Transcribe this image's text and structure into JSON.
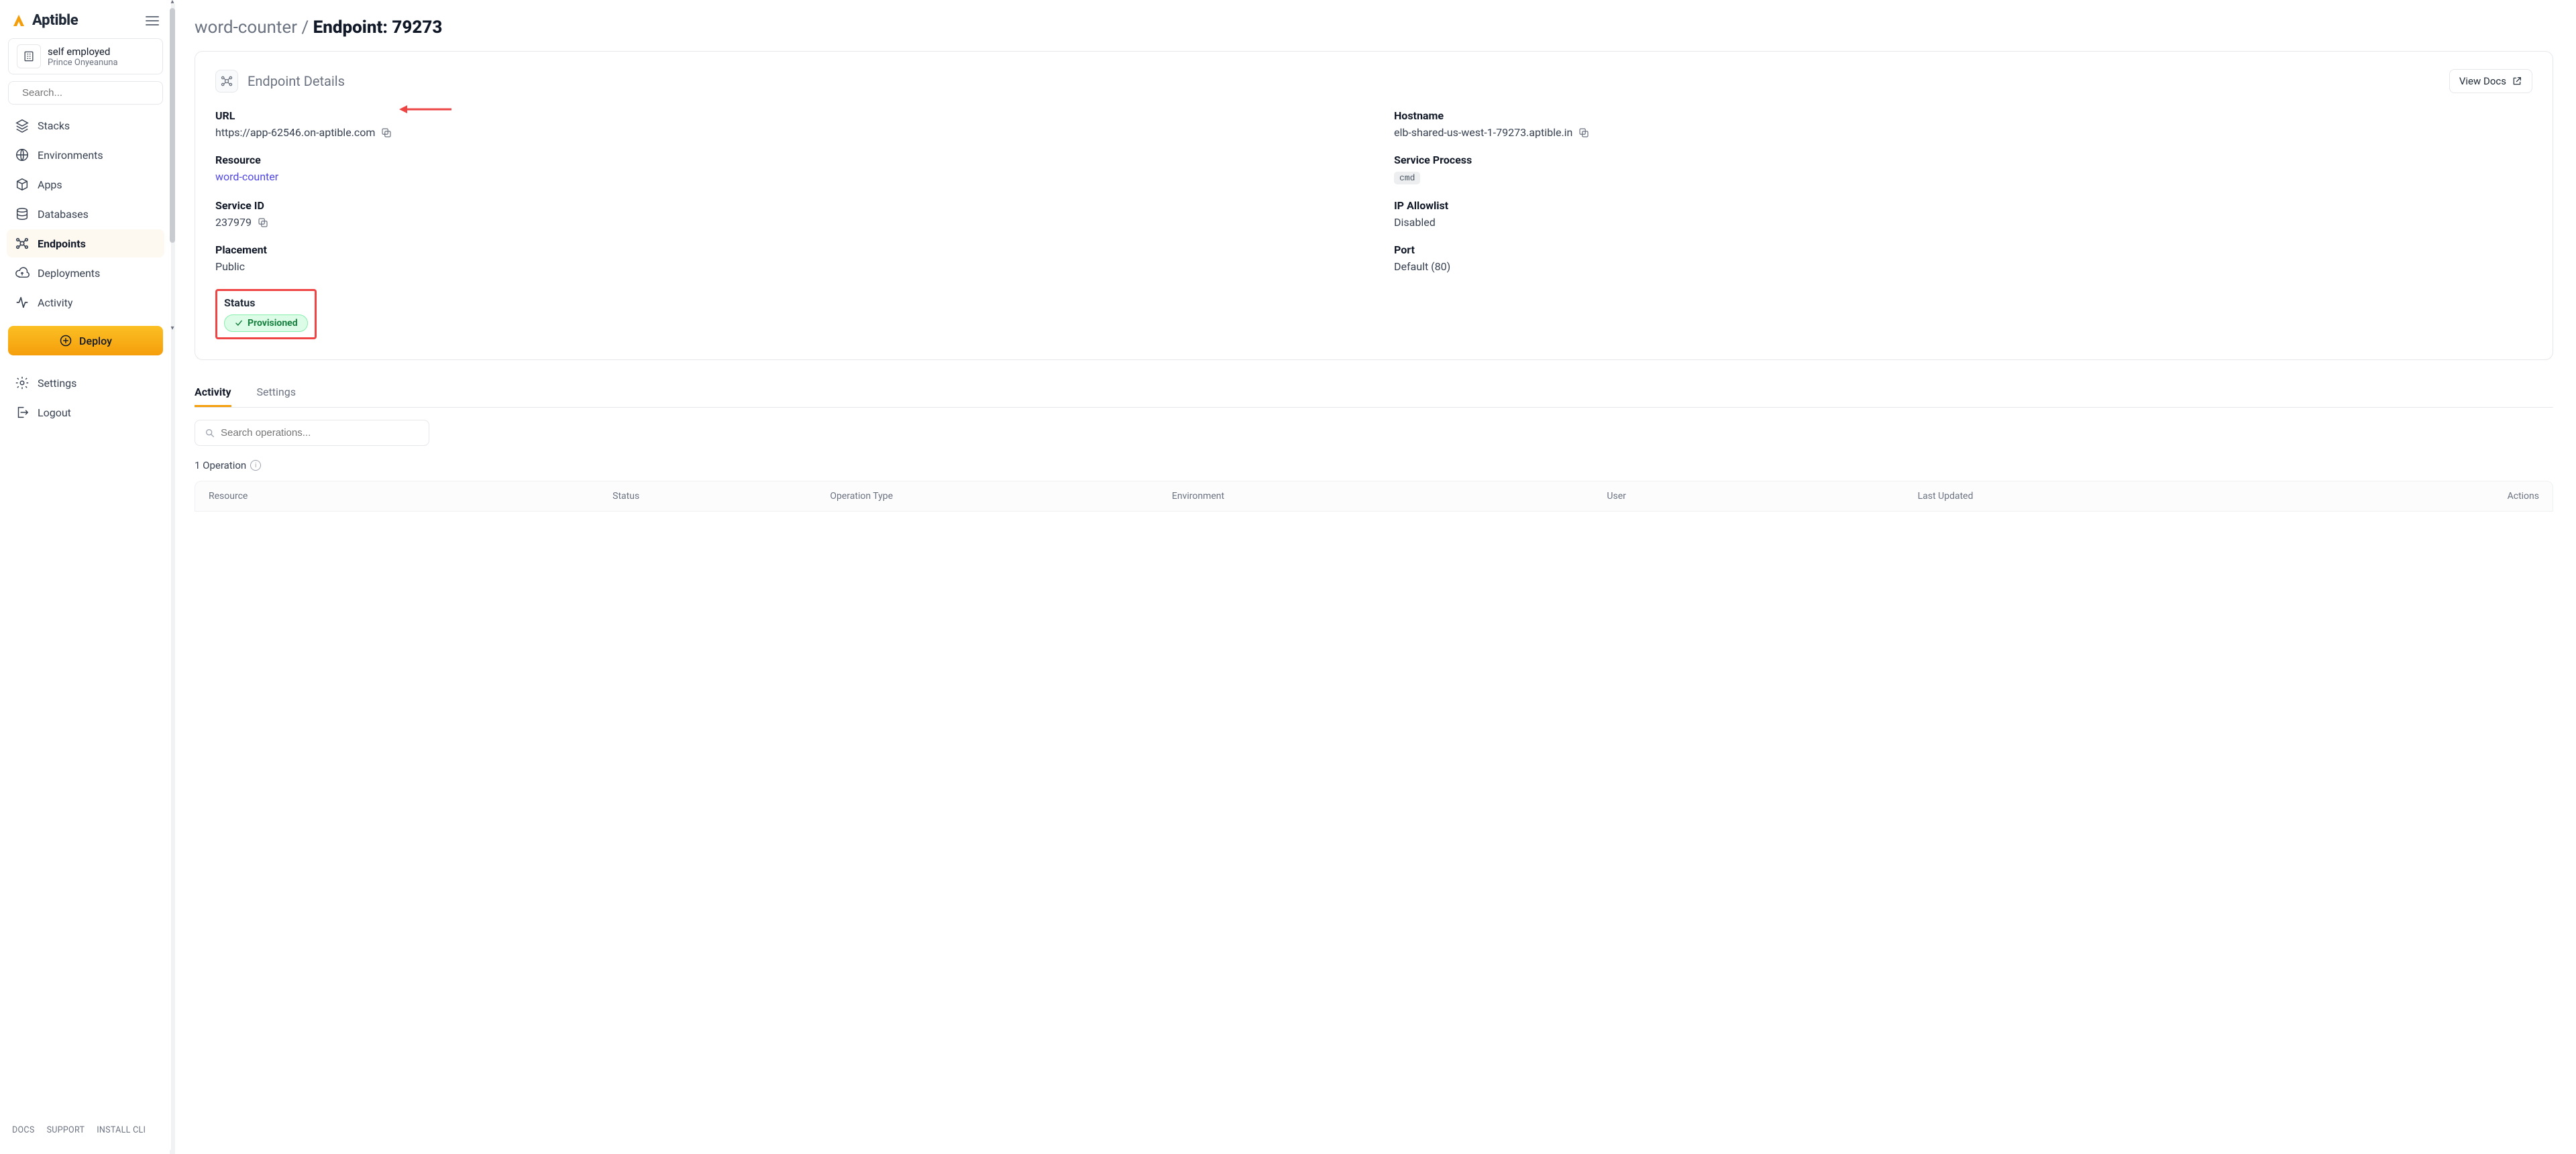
{
  "brand": "Aptible",
  "org": {
    "name": "self employed",
    "sub": "Prince Onyeanuna"
  },
  "search": {
    "placeholder": "Search..."
  },
  "nav": {
    "items": [
      {
        "label": "Stacks"
      },
      {
        "label": "Environments"
      },
      {
        "label": "Apps"
      },
      {
        "label": "Databases"
      },
      {
        "label": "Endpoints"
      },
      {
        "label": "Deployments"
      },
      {
        "label": "Activity"
      }
    ],
    "deploy": "Deploy",
    "settings": "Settings",
    "logout": "Logout"
  },
  "footerLinks": [
    "DOCS",
    "SUPPORT",
    "INSTALL CLI"
  ],
  "breadcrumb": {
    "app": "word-counter",
    "sep": "/",
    "pageLabel": "Endpoint:",
    "id": "79273"
  },
  "panel": {
    "title": "Endpoint Details",
    "viewDocs": "View Docs"
  },
  "details": {
    "url": {
      "label": "URL",
      "value": "https://app-62546.on-aptible.com"
    },
    "hostname": {
      "label": "Hostname",
      "value": "elb-shared-us-west-1-79273.aptible.in"
    },
    "resource": {
      "label": "Resource",
      "value": "word-counter"
    },
    "serviceProcess": {
      "label": "Service Process",
      "value": "cmd"
    },
    "serviceId": {
      "label": "Service ID",
      "value": "237979"
    },
    "ipAllowlist": {
      "label": "IP Allowlist",
      "value": "Disabled"
    },
    "placement": {
      "label": "Placement",
      "value": "Public"
    },
    "port": {
      "label": "Port",
      "value": "Default (80)"
    },
    "status": {
      "label": "Status",
      "value": "Provisioned"
    }
  },
  "tabs": {
    "activity": "Activity",
    "settings": "Settings"
  },
  "ops": {
    "searchPlaceholder": "Search operations...",
    "count": "1 Operation"
  },
  "tableHead": [
    "Resource",
    "Status",
    "Operation Type",
    "Environment",
    "User",
    "Last Updated",
    "Actions"
  ]
}
